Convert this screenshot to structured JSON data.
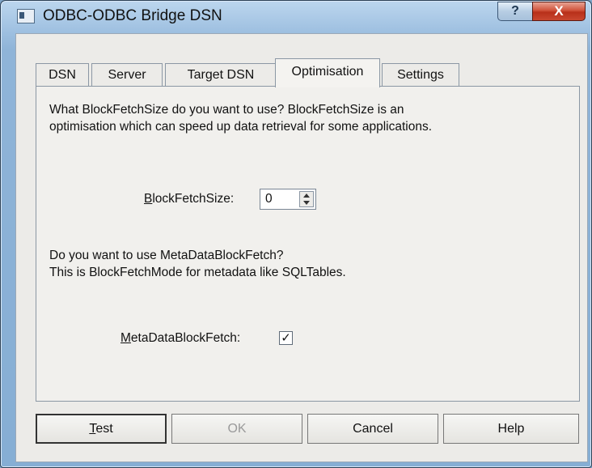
{
  "window": {
    "title": "ODBC-ODBC Bridge DSN"
  },
  "titlebar": {
    "help_label": "?",
    "close_label": "X"
  },
  "tabs": [
    {
      "label": "DSN"
    },
    {
      "label": "Server"
    },
    {
      "label": "Target DSN"
    },
    {
      "label": "Optimisation",
      "active": true
    },
    {
      "label": "Settings"
    }
  ],
  "optimisation": {
    "blockfetch_desc_line1": "What BlockFetchSize do you want to use? BlockFetchSize is an",
    "blockfetch_desc_line2": "optimisation which can speed up data retrieval for some applications.",
    "blockfetch_label_mnemonic": "B",
    "blockfetch_label_rest": "lockFetchSize:",
    "blockfetch_value": "0",
    "meta_desc_line1": "Do you want to use MetaDataBlockFetch?",
    "meta_desc_line2": "This is BlockFetchMode for metadata like SQLTables.",
    "meta_label_mnemonic": "M",
    "meta_label_rest": "etaDataBlockFetch:",
    "meta_checked": true,
    "meta_check_glyph": "✓"
  },
  "buttons": {
    "test_mnemonic": "T",
    "test_rest": "est",
    "ok": "OK",
    "cancel": "Cancel",
    "help": "Help"
  }
}
